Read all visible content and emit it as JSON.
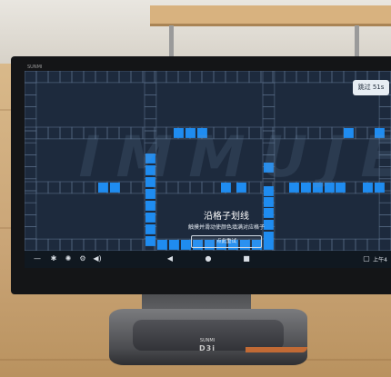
{
  "scene": {
    "monitor_brand": "SUNMI",
    "base_brand": "SUNMI",
    "base_model": "D3i"
  },
  "screen": {
    "watermark": "IMMUJE",
    "skip_button": "跳过 51s",
    "dialog": {
      "title": "沿格子划线",
      "subtitle": "触摸并滑动使颜色填满对应格子",
      "retry_button": "点此重试"
    },
    "navbar": {
      "icons": [
        "minus-icon",
        "bluetooth-icon",
        "brightness-icon",
        "settings-icon",
        "volume-icon",
        "back-icon",
        "home-icon",
        "recents-icon"
      ],
      "time": "上午4"
    },
    "colors": {
      "screen_bg": "#1d2a3d",
      "grid_line": "#5a6f89",
      "filled_cell": "#1f8cf0",
      "navbar_bg": "#101820"
    }
  }
}
